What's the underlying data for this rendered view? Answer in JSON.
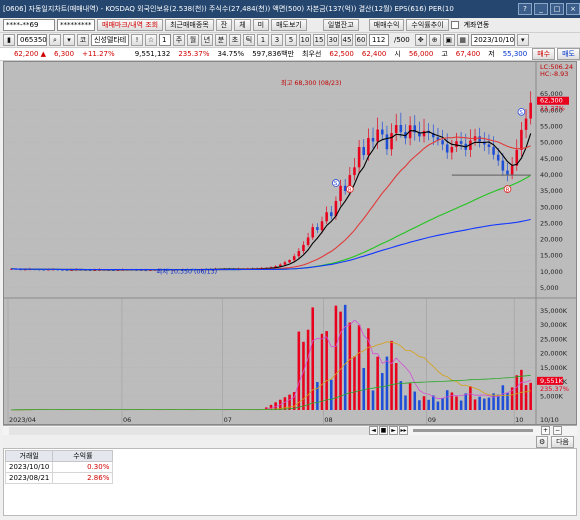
{
  "window": {
    "title": "[0606] 자동일지차트(매매내역) - KOSDAQ 외국인보유(2.538(천)) 주식수(27,484(천)) 액면(500) 자본금(137(억)) 결산(12월) EPS(616) PER(10",
    "controls": [
      "?",
      "_",
      "□",
      "×"
    ]
  },
  "toolbar1": {
    "account": "****-**69",
    "password": "*********",
    "buttons": [
      "매매마크/내역 조회",
      "최근매매종목",
      "잔",
      "체",
      "미",
      "매도보기",
      "일별잔고",
      "매매수익",
      "수익률추이"
    ],
    "checkbox_label": "계좌연동"
  },
  "toolbar2": {
    "code": "065350",
    "name": "신성델타테",
    "period_buttons": [
      "주",
      "월",
      "년",
      "분",
      "초",
      "틱"
    ],
    "interval_buttons": [
      "1",
      "3",
      "5",
      "10",
      "15",
      "30",
      "45",
      "60"
    ],
    "count": "112",
    "count_total": "/500",
    "date": "2023/10/10"
  },
  "quote": {
    "price": "62,200 ▲",
    "change": "6,300",
    "rate": "+11.27%",
    "volume": "9,551,132",
    "vol_rate": "235.37%",
    "turnover": "34.75%",
    "amount": "597,836백만",
    "best_label": "최우선",
    "ask": "62,500",
    "bid": "62,400",
    "open_label": "시",
    "open": "56,000",
    "high_label": "고",
    "high": "67,400",
    "low_label": "저",
    "low": "55,300",
    "buy_btn": "매수",
    "sell_btn": "매도"
  },
  "chart_data": [
    {
      "type": "candlestick",
      "title": "",
      "top_left_labels": [
        "LC:506.24",
        "HC:-8.93"
      ],
      "ylim": [
        3000,
        68000
      ],
      "y_ticks": [
        "65,000",
        "60,000",
        "55,000",
        "50,000",
        "45,000",
        "40,000",
        "35,000",
        "30,000",
        "25,000",
        "20,000",
        "15,000",
        "10,000",
        "5,000"
      ],
      "current_price_tag": "62,300",
      "current_rate_tag": "11.27%",
      "annotations": {
        "high": "최고 68,300 (08/23)",
        "low": "최저 10,350 (06/13)"
      },
      "close_series": [
        10800,
        10700,
        10600,
        10650,
        10700,
        10650,
        10600,
        10550,
        10600,
        10650,
        10550,
        10500,
        10450,
        10500,
        10600,
        10550,
        10500,
        10450,
        10500,
        10550,
        10500,
        10450,
        10400,
        10450,
        10500,
        10550,
        10500,
        10450,
        10400,
        10350,
        10450,
        10500,
        10550,
        10500,
        10450,
        10500,
        10550,
        10600,
        10550,
        10500,
        10600,
        10700,
        10650,
        10600,
        10700,
        10750,
        10800,
        10700,
        10650,
        10700,
        10800,
        10900,
        10850,
        10800,
        10950,
        11100,
        11300,
        11600,
        12100,
        12800,
        13500,
        14700,
        16300,
        18200,
        20500,
        23700,
        22800,
        25500,
        28300,
        27100,
        31800,
        36500,
        34900,
        39800,
        42200,
        48500,
        46000,
        51300,
        50200,
        53900,
        52400,
        47800,
        52800,
        55300,
        53100,
        51200,
        55200,
        53000,
        51800,
        53500,
        52800,
        51500,
        50600,
        49300,
        46800,
        48500,
        50300,
        49500,
        47600,
        50500,
        51800,
        50200,
        49300,
        48500,
        46100,
        44300,
        41200,
        39800,
        42700,
        47600,
        53800,
        57300,
        62200
      ],
      "moving_averages": [
        "5",
        "20",
        "60",
        "120"
      ],
      "baseline": "39,800"
    },
    {
      "type": "bar",
      "title": "",
      "ylim": [
        0,
        38000
      ],
      "y_ticks": [
        "35,000K",
        "30,000K",
        "25,000K",
        "20,000K",
        "15,000K",
        "10,000K",
        "5,000K"
      ],
      "current_volume_tag": "9,551K",
      "current_rate_tag": "235.37%",
      "x_ticks": [
        "2023/04",
        "06",
        "07",
        "08",
        "09",
        "10",
        "10/10"
      ]
    }
  ],
  "scrollbar": {
    "buttons": [
      "◄",
      "■",
      "►",
      "▸▸",
      "|",
      "+",
      "−"
    ]
  },
  "bottom_buttons": {
    "compare": "",
    "next": "다음"
  },
  "history_table": {
    "headers": [
      "거래일",
      "수익률"
    ],
    "rows": [
      {
        "date": "2023/10/10",
        "rate": "0.30%"
      },
      {
        "date": "2023/08/21",
        "rate": "2.86%"
      }
    ]
  },
  "colors": {
    "up": "#e8001c",
    "down": "#1f4fd6",
    "chart_bg": "#bcbcbc",
    "titlebar": "#24466f"
  }
}
